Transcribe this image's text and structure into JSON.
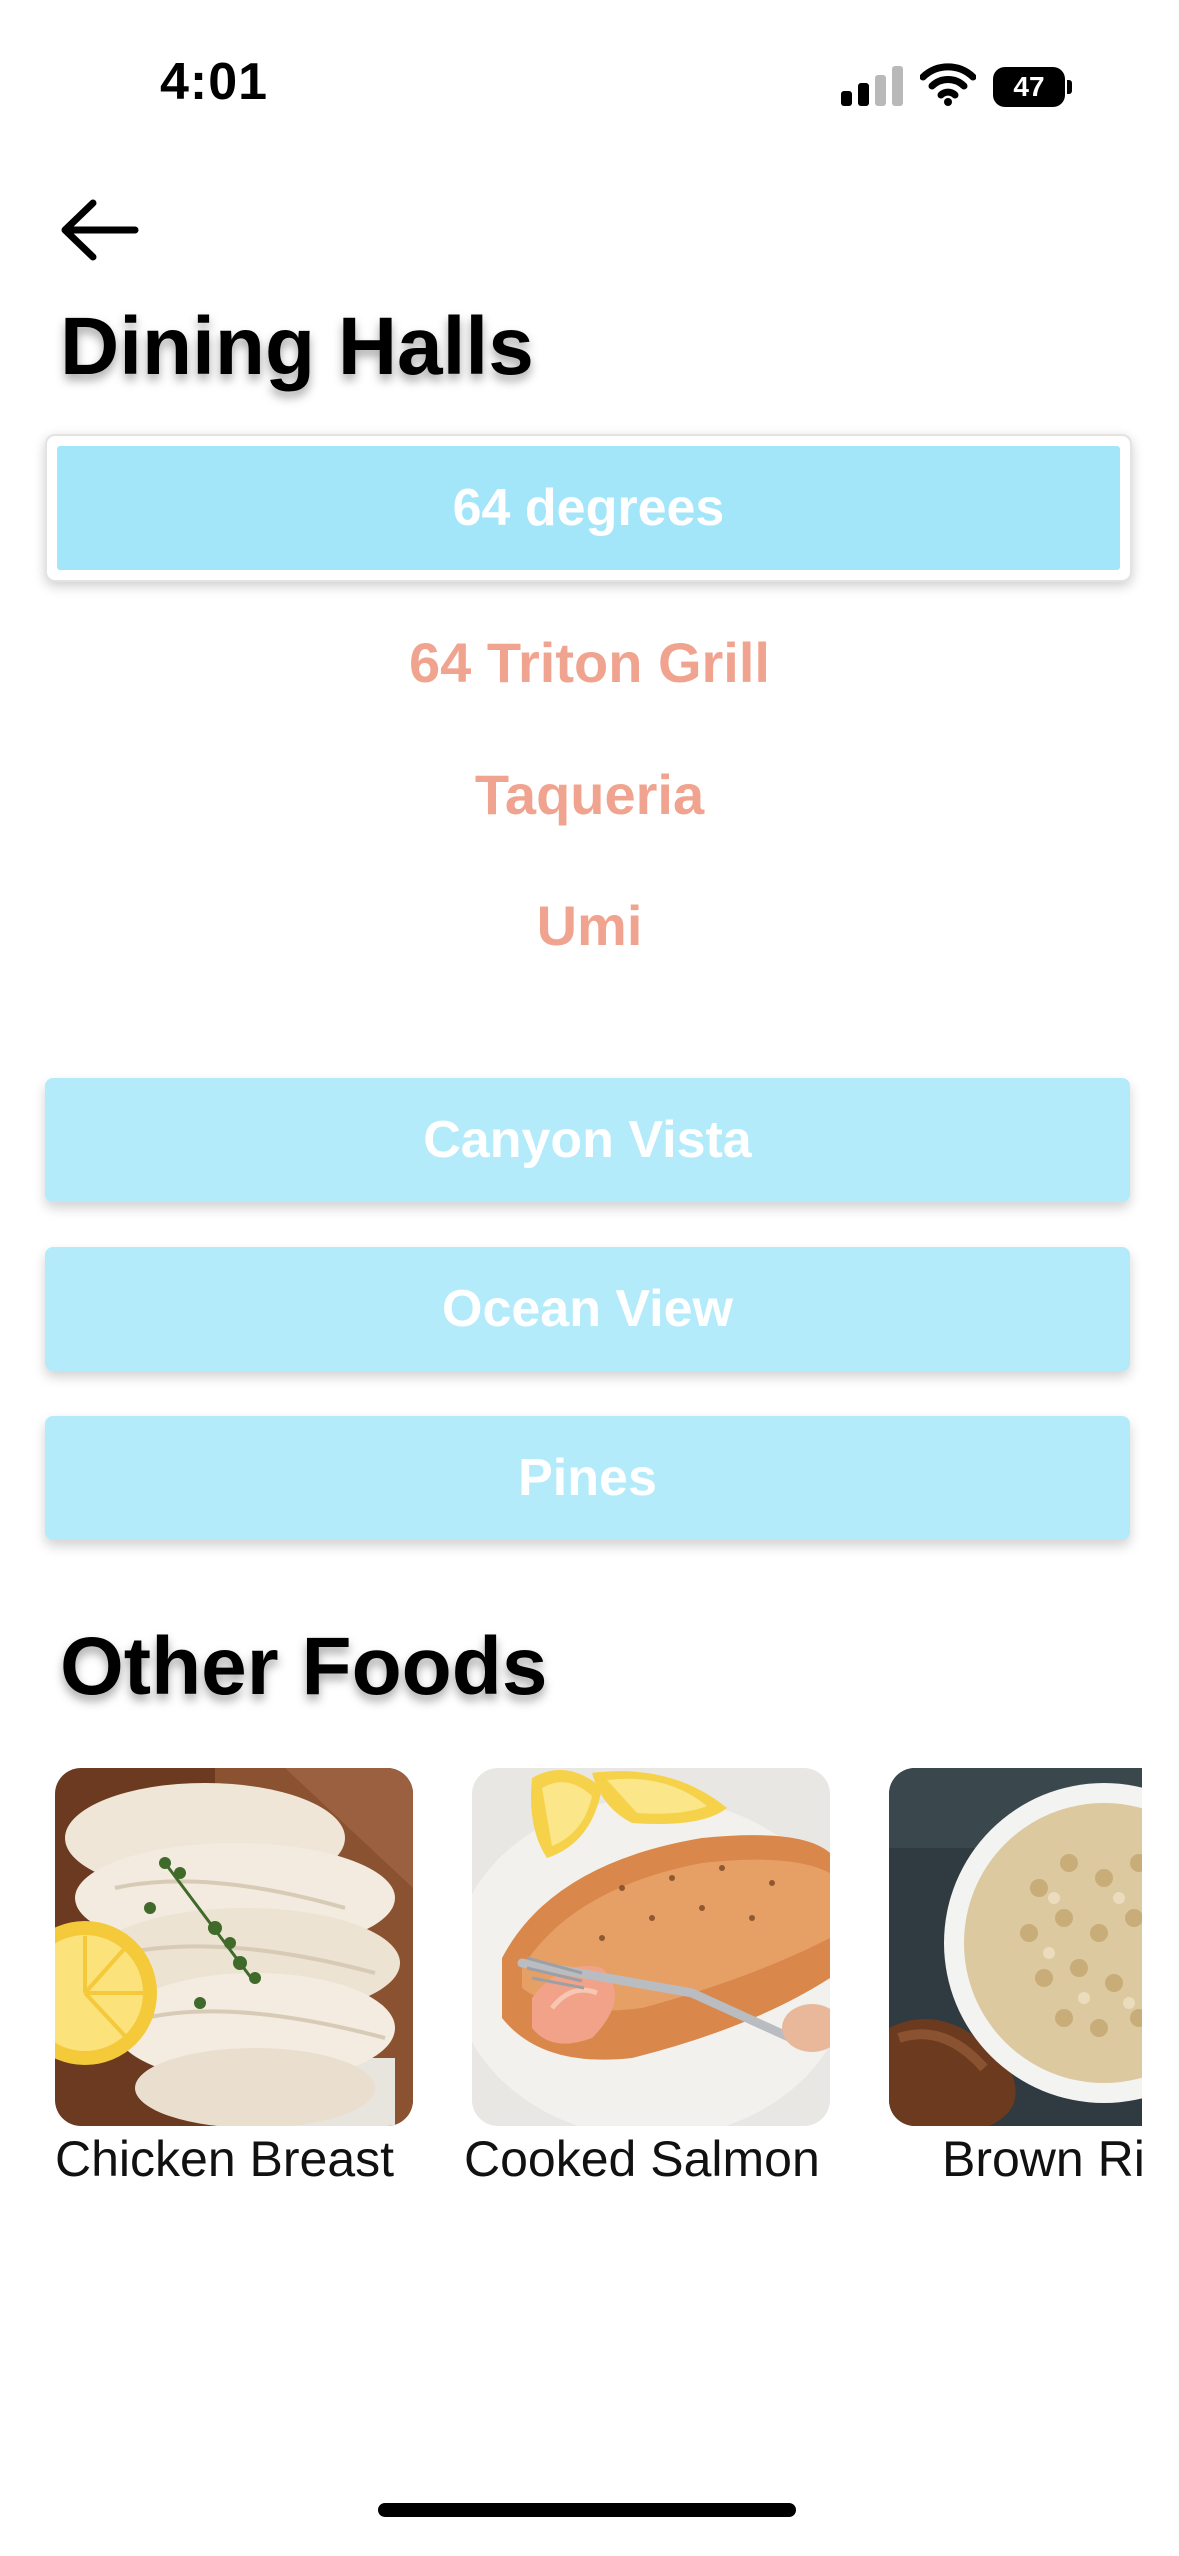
{
  "status_bar": {
    "time": "4:01",
    "battery": "47",
    "signal_icon": "cellular-signal-icon",
    "wifi_icon": "wifi-icon",
    "battery_icon": "battery-icon"
  },
  "header": {
    "back_icon": "arrow-left-icon"
  },
  "dining_halls": {
    "title": "Dining Halls",
    "expanded": {
      "label": "64 degrees",
      "locations": [
        "64 Triton Grill",
        "Taqueria",
        "Umi"
      ]
    },
    "halls": [
      "Canyon Vista",
      "Ocean View",
      "Pines"
    ]
  },
  "other_foods": {
    "title": "Other Foods",
    "items": [
      {
        "label": "Chicken Breast",
        "image": "chicken-breast-photo"
      },
      {
        "label": "Cooked Salmon",
        "image": "cooked-salmon-photo"
      },
      {
        "label": "Brown Rice",
        "image": "brown-rice-photo"
      }
    ]
  },
  "colors": {
    "hall_button": "#b3ebfb",
    "hall_button_selected": "#a3e6f9",
    "sub_location_text": "#f0a48f"
  }
}
